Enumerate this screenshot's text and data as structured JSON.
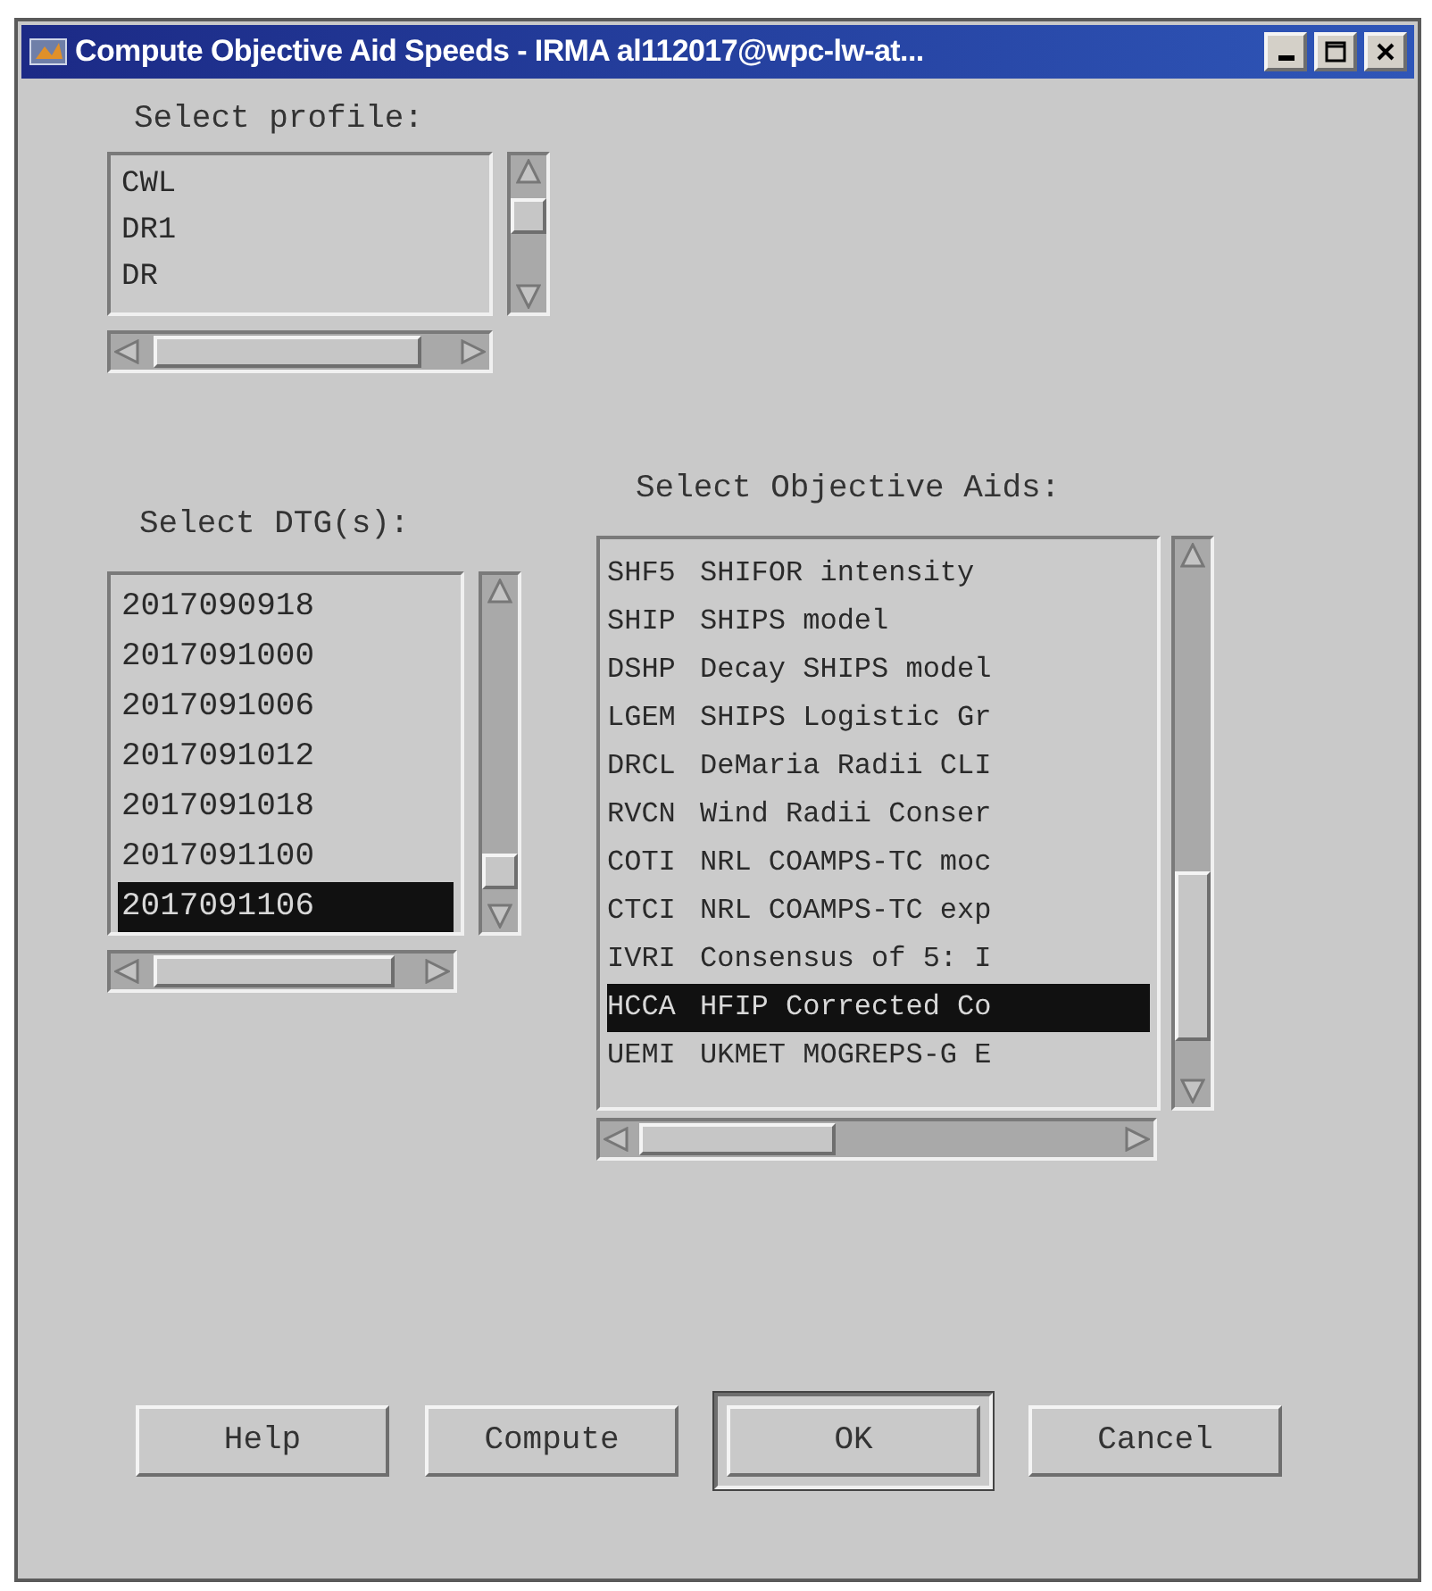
{
  "window": {
    "title": "Compute Objective Aid Speeds - IRMA al112017@wpc-lw-at..."
  },
  "profile": {
    "label": "Select profile:",
    "items": [
      {
        "text": "CWL",
        "selected": false
      },
      {
        "text": "DR1",
        "selected": false
      },
      {
        "text": "DR",
        "selected": false
      }
    ]
  },
  "dtg": {
    "label": "Select DTG(s):",
    "items": [
      {
        "text": "2017090918",
        "selected": false
      },
      {
        "text": "2017091000",
        "selected": false
      },
      {
        "text": "2017091006",
        "selected": false
      },
      {
        "text": "2017091012",
        "selected": false
      },
      {
        "text": "2017091018",
        "selected": false
      },
      {
        "text": "2017091100",
        "selected": false
      },
      {
        "text": "2017091106",
        "selected": true
      }
    ]
  },
  "aids": {
    "label": "Select Objective Aids:",
    "items": [
      {
        "code": "SHF5",
        "description": "SHIFOR intensity",
        "selected": false
      },
      {
        "code": "SHIP",
        "description": "SHIPS model",
        "selected": false
      },
      {
        "code": "DSHP",
        "description": "Decay SHIPS model",
        "selected": false
      },
      {
        "code": "LGEM",
        "description": "SHIPS Logistic Gr",
        "selected": false
      },
      {
        "code": "DRCL",
        "description": "DeMaria Radii CLI",
        "selected": false
      },
      {
        "code": "RVCN",
        "description": "Wind Radii Conser",
        "selected": false
      },
      {
        "code": "COTI",
        "description": "NRL COAMPS-TC moc",
        "selected": false
      },
      {
        "code": "CTCI",
        "description": "NRL COAMPS-TC exp",
        "selected": false
      },
      {
        "code": "IVRI",
        "description": "Consensus of 5: I",
        "selected": false
      },
      {
        "code": "HCCA",
        "description": "HFIP Corrected Co",
        "selected": true
      },
      {
        "code": "UEMI",
        "description": "UKMET MOGREPS-G E",
        "selected": false
      }
    ]
  },
  "buttons": [
    {
      "label": "Help",
      "default": false
    },
    {
      "label": "Compute",
      "default": false
    },
    {
      "label": "OK",
      "default": true
    },
    {
      "label": "Cancel",
      "default": false
    }
  ]
}
